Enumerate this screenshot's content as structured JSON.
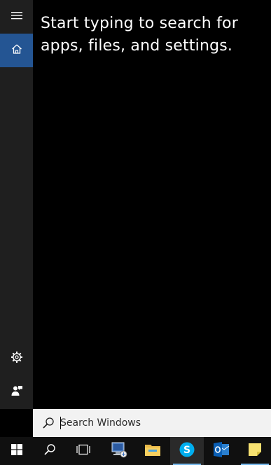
{
  "rail": {
    "items": [
      {
        "id": "menu",
        "icon": "hamburger-icon"
      },
      {
        "id": "home",
        "icon": "home-icon",
        "selected": true
      },
      {
        "id": "settings",
        "icon": "gear-icon"
      },
      {
        "id": "feedback",
        "icon": "feedback-icon"
      }
    ]
  },
  "main": {
    "hint": "Start typing to search for apps, files, and settings."
  },
  "search": {
    "placeholder": "Search Windows",
    "value": ""
  },
  "taskbar": {
    "items": [
      {
        "id": "start",
        "icon": "windows-logo-icon"
      },
      {
        "id": "search",
        "icon": "search-icon"
      },
      {
        "id": "task-view",
        "icon": "task-view-icon"
      },
      {
        "id": "network-app",
        "icon": "computer-network-icon"
      },
      {
        "id": "file-explorer",
        "icon": "folder-icon"
      },
      {
        "id": "skype",
        "icon": "skype-icon",
        "active": true
      },
      {
        "id": "outlook",
        "icon": "outlook-icon"
      },
      {
        "id": "sticky-notes",
        "icon": "sticky-notes-icon"
      }
    ]
  },
  "colors": {
    "accent": "#245593",
    "rail_bg": "#1f1f1f",
    "taskbar_bg": "#101010",
    "searchbar_bg": "#f2f2f2",
    "active_underline": "#76b9ed"
  }
}
